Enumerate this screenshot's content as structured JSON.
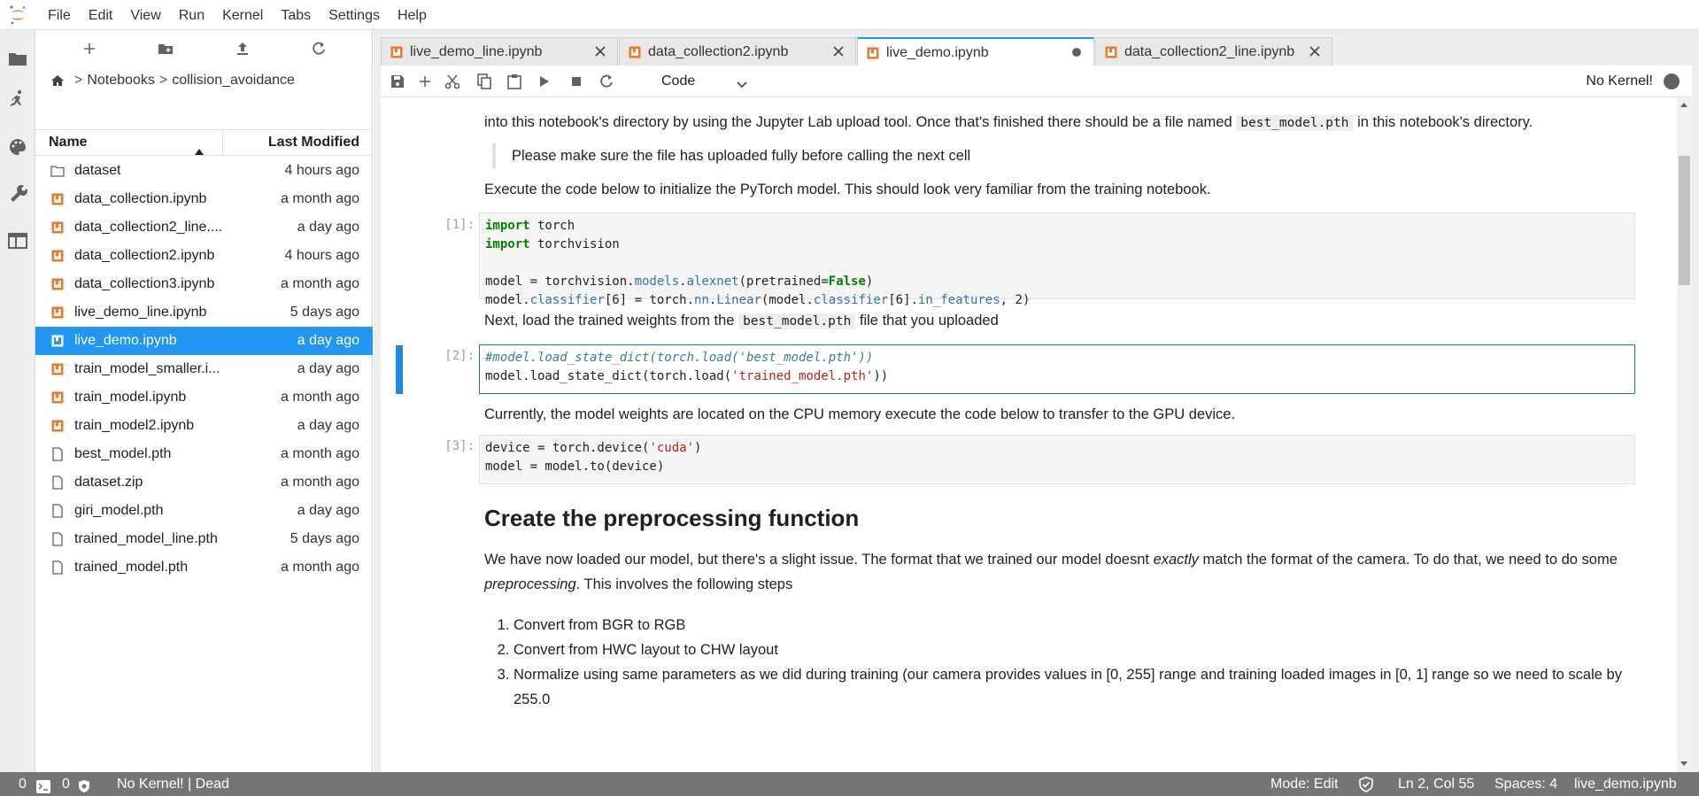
{
  "menu": [
    "File",
    "Edit",
    "View",
    "Run",
    "Kernel",
    "Tabs",
    "Settings",
    "Help"
  ],
  "filebrowser": {
    "breadcrumb": [
      "Notebooks",
      "collision_avoidance"
    ],
    "breadcrumb_sep": ">",
    "col_name": "Name",
    "col_modified": "Last Modified",
    "files": [
      {
        "name": "dataset",
        "modified": "4 hours ago",
        "type": "folder"
      },
      {
        "name": "data_collection.ipynb",
        "modified": "a month ago",
        "type": "notebook"
      },
      {
        "name": "data_collection2_line....",
        "modified": "a day ago",
        "type": "notebook"
      },
      {
        "name": "data_collection2.ipynb",
        "modified": "4 hours ago",
        "type": "notebook"
      },
      {
        "name": "data_collection3.ipynb",
        "modified": "a month ago",
        "type": "notebook"
      },
      {
        "name": "live_demo_line.ipynb",
        "modified": "5 days ago",
        "type": "notebook"
      },
      {
        "name": "live_demo.ipynb",
        "modified": "a day ago",
        "type": "notebook",
        "selected": true
      },
      {
        "name": "train_model_smaller.i...",
        "modified": "a day ago",
        "type": "notebook"
      },
      {
        "name": "train_model.ipynb",
        "modified": "a month ago",
        "type": "notebook"
      },
      {
        "name": "train_model2.ipynb",
        "modified": "a day ago",
        "type": "notebook"
      },
      {
        "name": "best_model.pth",
        "modified": "a month ago",
        "type": "file"
      },
      {
        "name": "dataset.zip",
        "modified": "a month ago",
        "type": "file"
      },
      {
        "name": "giri_model.pth",
        "modified": "a day ago",
        "type": "file"
      },
      {
        "name": "trained_model_line.pth",
        "modified": "5 days ago",
        "type": "file"
      },
      {
        "name": "trained_model.pth",
        "modified": "a month ago",
        "type": "file"
      }
    ]
  },
  "tabs": [
    {
      "label": "live_demo_line.ipynb",
      "active": false
    },
    {
      "label": "data_collection2.ipynb",
      "active": false
    },
    {
      "label": "live_demo.ipynb",
      "active": true,
      "dirty": true
    },
    {
      "label": "data_collection2_line.ipynb",
      "active": false
    }
  ],
  "toolbar": {
    "cell_type": "Code",
    "kernel": "No Kernel!"
  },
  "notebook": {
    "md1": "into this notebook's directory by using the Jupyter Lab upload tool. Once that's finished there should be a file named",
    "md1_code": "best_model.pth",
    "md1_tail": "in this notebook's directory.",
    "quote": "Please make sure the file has uploaded fully before calling the next cell",
    "md2": "Execute the code below to initialize the PyTorch model. This should look very familiar from the training notebook.",
    "prompt1": "[1]:",
    "md3_pre": "Next, load the trained weights from the",
    "md3_code": "best_model.pth",
    "md3_post": "file that you uploaded",
    "prompt2": "[2]:",
    "md4": "Currently, the model weights are located on the CPU memory execute the code below to transfer to the GPU device.",
    "prompt3": "[3]:",
    "heading": "Create the preprocessing function",
    "md5_a": "We have now loaded our model, but there's a slight issue. The format that we trained our model doesnt",
    "md5_em1": "exactly",
    "md5_b": "match the format of the camera. To do that, we need to do some",
    "md5_em2": "preprocessing",
    "md5_c": ". This involves the following steps",
    "steps": [
      "Convert from BGR to RGB",
      "Convert from HWC layout to CHW layout",
      "Normalize using same parameters as we did during training (our camera provides values in [0, 255] range and training loaded images in [0, 1] range so we need to scale by 255.0"
    ]
  },
  "statusbar": {
    "count1": "0",
    "count2": "0",
    "kernel": "No Kernel! | Dead",
    "mode": "Mode: Edit",
    "position": "Ln 2, Col 55",
    "spaces": "Spaces: 4",
    "filename": "live_demo.ipynb"
  }
}
